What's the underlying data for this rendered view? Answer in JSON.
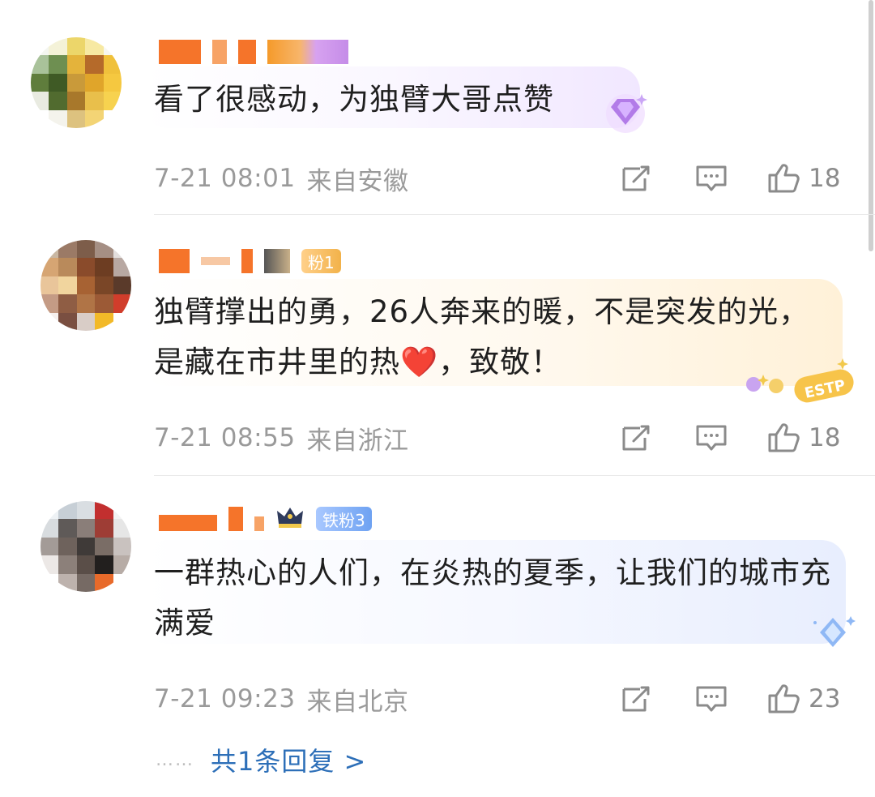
{
  "comments": [
    {
      "text": "看了很感动，为独臂大哥点赞",
      "time": "7-21 08:01",
      "location": "来自安徽",
      "likes": "18",
      "badge": "",
      "decoration": "purple-diamond"
    },
    {
      "text": "独臂撑出的勇，26人奔来的暖，不是突发的光，是藏在市井里的热❤️，致敬！",
      "time": "7-21 08:55",
      "location": "来自浙江",
      "likes": "18",
      "badge": "粉1",
      "decoration_text": "ESTP"
    },
    {
      "text": "一群热心的人们，在炎热的夏季，让我们的城市充满爱",
      "time": "7-21 09:23",
      "location": "来自北京",
      "likes": "23",
      "badge": "铁粉3",
      "decoration": "blue-diamond"
    }
  ],
  "reply": {
    "dots": "……",
    "label": "共1条回复 >"
  },
  "icons": {
    "repost": "repost-icon",
    "comment": "comment-icon",
    "like": "thumbs-up-icon"
  },
  "colors": {
    "meta_gray": "#9a9a9a",
    "link_blue": "#2d6fb8",
    "badge_blue": "#6ea2f2"
  }
}
